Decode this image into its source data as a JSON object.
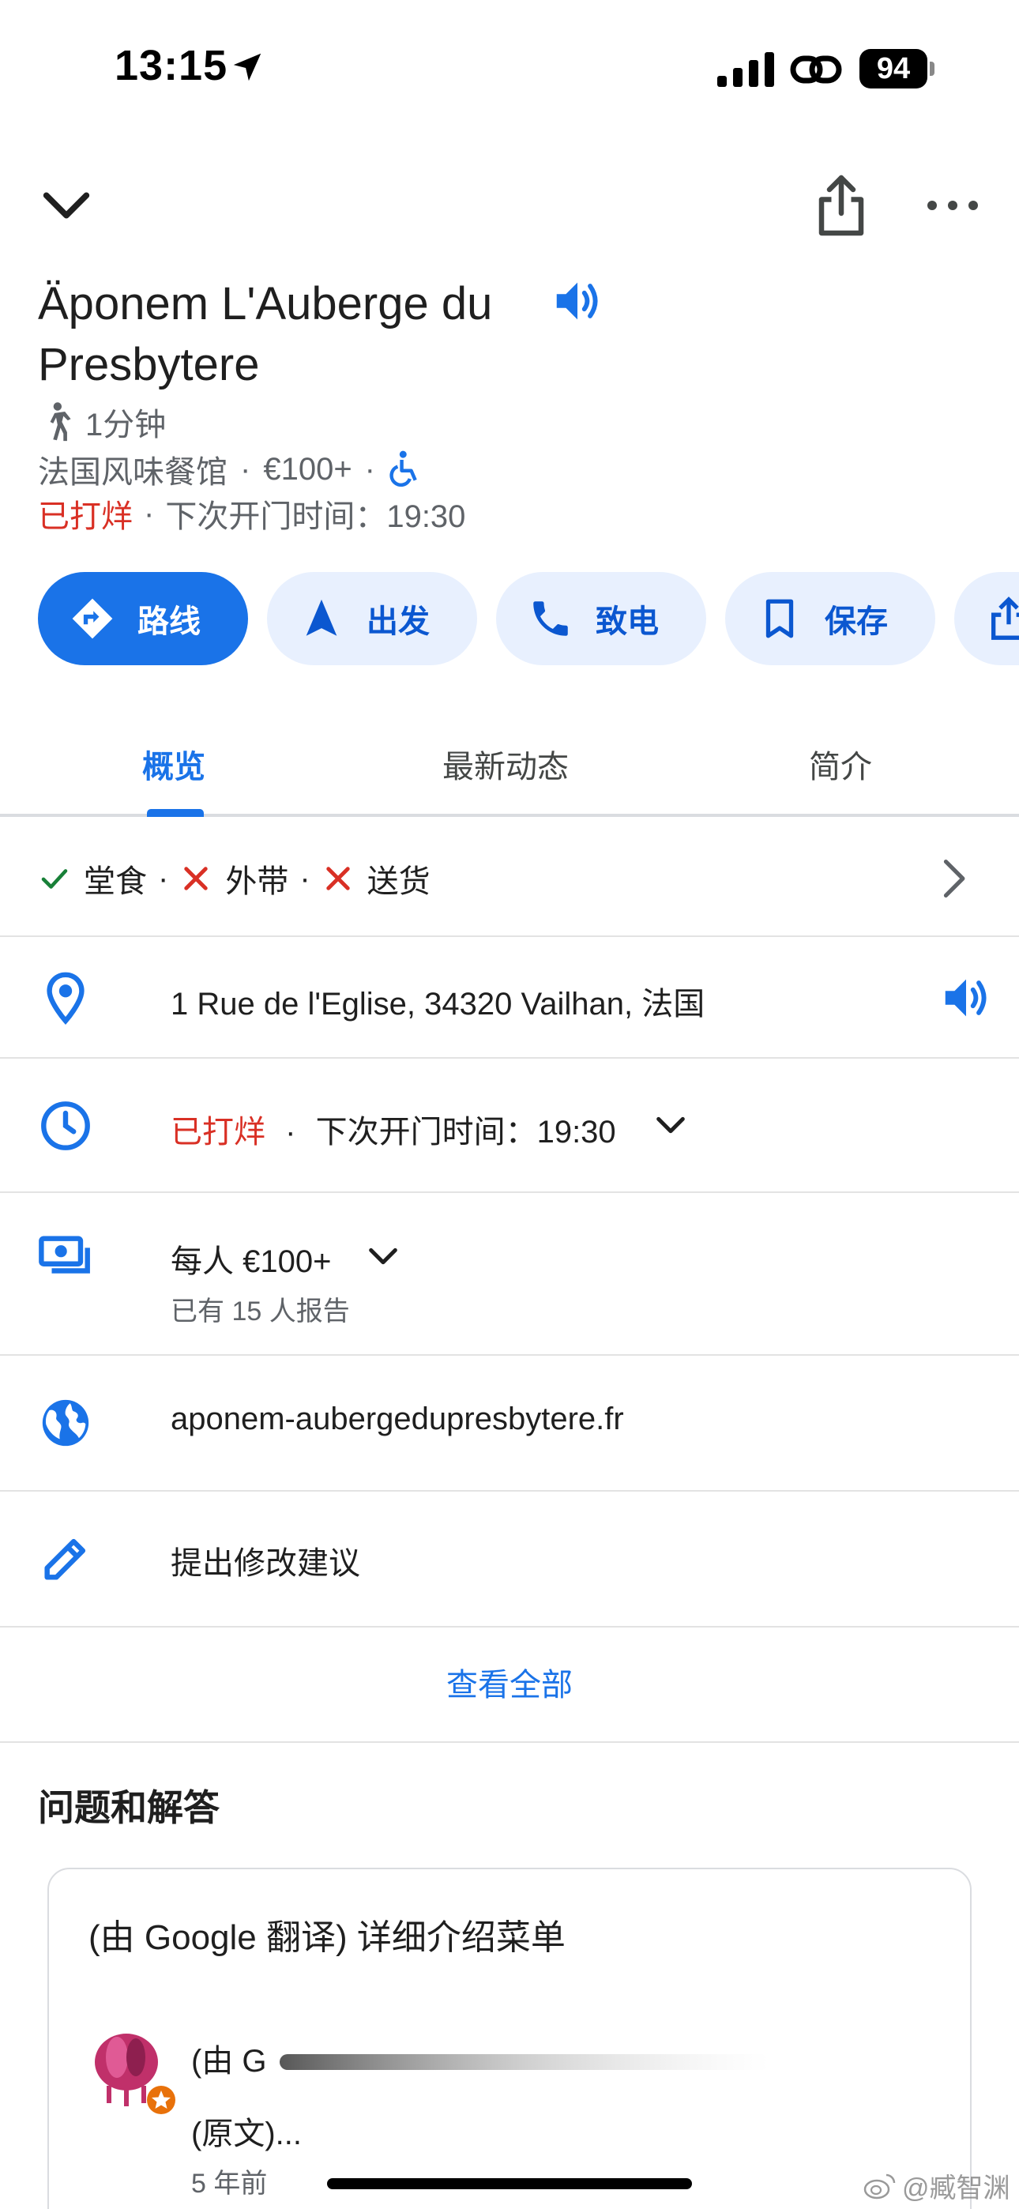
{
  "status_bar": {
    "time": "13:15",
    "battery": "94"
  },
  "place": {
    "title": "Äponem L'Auberge du Presbytere",
    "walk_time": "1分钟",
    "category": "法国风味餐馆",
    "price": "€100+",
    "status_closed": "已打烊",
    "next_open": "下次开门时间：19:30"
  },
  "actions": [
    {
      "label": "路线",
      "icon": "directions-icon"
    },
    {
      "label": "出发",
      "icon": "navigation-icon"
    },
    {
      "label": "致电",
      "icon": "phone-icon"
    },
    {
      "label": "保存",
      "icon": "bookmark-icon"
    }
  ],
  "tabs": [
    "概览",
    "最新动态",
    "简介"
  ],
  "services": {
    "dine_in": "堂食",
    "takeout": "外带",
    "delivery": "送货"
  },
  "info": {
    "address": "1 Rue de l'Eglise, 34320 Vailhan, 法国",
    "hours_closed": "已打烊",
    "hours_next": "下次开门时间：19:30",
    "price_per_person": "每人 €100+",
    "price_reports": "已有 15 人报告",
    "website": "aponem-aubergedupresbytere.fr",
    "suggest_edit": "提出修改建议",
    "view_all": "查看全部"
  },
  "qa": {
    "heading": "问题和解答",
    "question": "(由 Google 翻译) 详细介绍菜单",
    "answer_prefix": "(由 G",
    "answer_original": "(原文)...",
    "time_ago": "5 年前"
  },
  "watermark": "@臧智渊",
  "colors": {
    "accent": "#1a73e8",
    "chip_bg": "#e8f0fe",
    "closed_red": "#d93025",
    "check_green": "#188038"
  }
}
